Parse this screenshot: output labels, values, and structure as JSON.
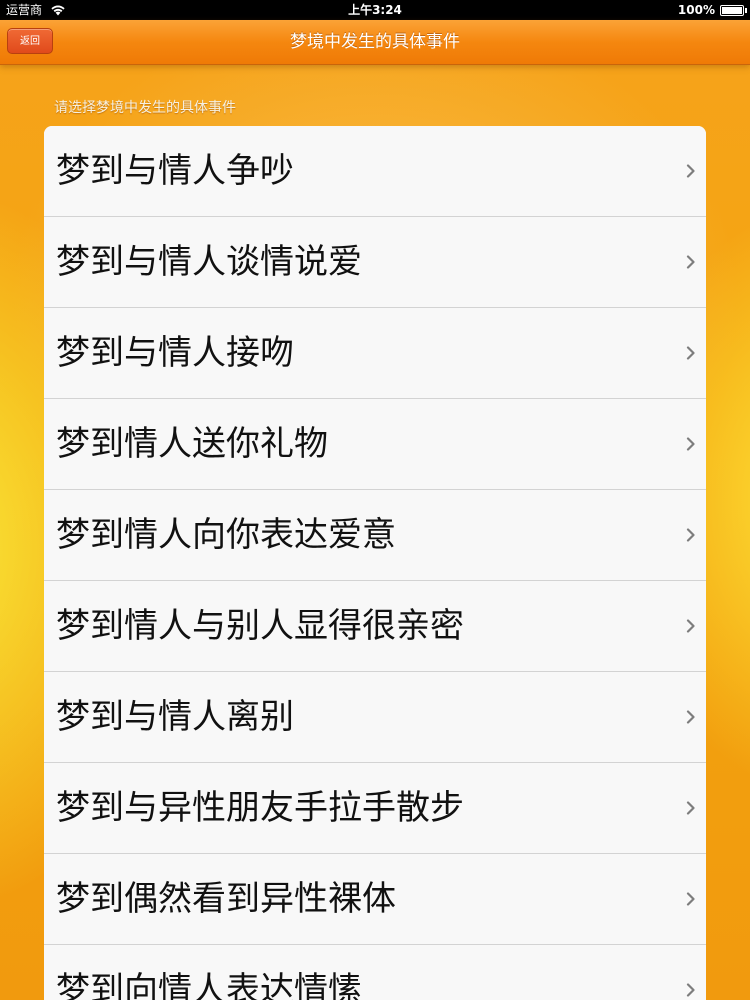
{
  "status_bar": {
    "carrier": "运营商",
    "time": "上午3:24",
    "battery": "100%"
  },
  "nav": {
    "back_label": "返回",
    "title": "梦境中发生的具体事件"
  },
  "section": {
    "header": "请选择梦境中发生的具体事件"
  },
  "list": {
    "items": [
      {
        "label": "梦到与情人争吵"
      },
      {
        "label": "梦到与情人谈情说爱"
      },
      {
        "label": "梦到与情人接吻"
      },
      {
        "label": "梦到情人送你礼物"
      },
      {
        "label": "梦到情人向你表达爱意"
      },
      {
        "label": "梦到情人与别人显得很亲密"
      },
      {
        "label": "梦到与情人离别"
      },
      {
        "label": "梦到与异性朋友手拉手散步"
      },
      {
        "label": "梦到偶然看到异性裸体"
      },
      {
        "label": "梦到向情人表达情愫"
      }
    ]
  },
  "icons": {
    "wifi": "wifi-icon",
    "battery": "battery-icon",
    "chevron": "chevron-right-icon"
  },
  "colors": {
    "nav_bar": "#f5870f",
    "back_button": "#e04a1b",
    "list_background": "#f8f8f8"
  }
}
